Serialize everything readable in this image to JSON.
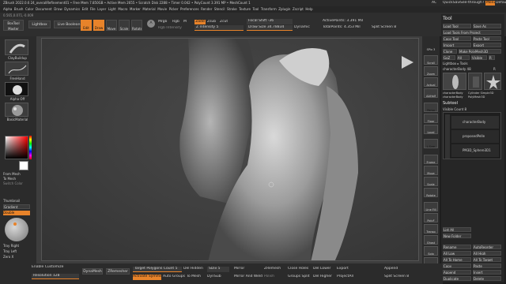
{
  "title_bar": {
    "text": "ZBrush 2022.0.6   24_overallRefinement01  •  Free Mem 7.850GB  •  Active Mem 2655  •  Scratch Disk 2288  •  Timer 0.042  •  PolyCount 3.391 MP  •  MeshCount 1",
    "right": [
      "AC",
      "QuickSave",
      "See-through 0",
      "Menus",
      "DefaultZScript"
    ]
  },
  "menu_bar": {
    "items": [
      "Alpha",
      "Brush",
      "Color",
      "Document",
      "Draw",
      "Dynamics",
      "Edit",
      "File",
      "Layer",
      "Light",
      "Macro",
      "Marker",
      "Material",
      "Movie",
      "Picker",
      "Preferences",
      "Render",
      "Stencil",
      "Stroke",
      "Texture",
      "Tool",
      "Transform",
      "Zplugin",
      "Zscript",
      "Help"
    ]
  },
  "coords": "0.565,0.071,-0.009",
  "top_shelf": {
    "boxes": [
      "BoxTool Master",
      "Lightbox",
      "Live Boolean"
    ],
    "modes": [
      "Edit",
      "Draw",
      "Move",
      "Scale",
      "Rotate"
    ],
    "a_label": "A",
    "mrgb": "Mrgb",
    "rgb": "Rgb",
    "m": "M",
    "zadd": "Zadd",
    "zsub": "Zsub",
    "zcut": "Zcut",
    "rgb_intensity": "Rgb Intensity",
    "z_intensity": "Z Intensity 5",
    "focal_shift": "Focal Shift -36",
    "draw_size": "Draw Size 34.78834",
    "dynamic": "Dynamic",
    "active_points": "ActivePoints: 3.391 Mil",
    "total_points": "TotalPoints: 4.353 Mil",
    "split_screen": "Split Screen 8"
  },
  "left_shelf": {
    "brush": "ClayBuildup",
    "stroke": "FreeHand",
    "alpha": "Alpha Off",
    "texture": "Texture Off",
    "material": "BasicMaterial",
    "from_mesh": "From Mesh",
    "to_mesh": "To Mesh",
    "switch_color": "Switch Color",
    "gradient": "Gradient",
    "thumbnail": "Thumbnail",
    "double": "Double",
    "tray_right": "Tray Right",
    "tray_left": "Tray Left",
    "zoom": "Zero X"
  },
  "right_shelf": {
    "items": [
      "SPix 3",
      "Scroll",
      "Zoom",
      "Actual",
      "AAHalf",
      "Persp",
      "Floor",
      "Local",
      "L.Sym",
      "Frame",
      "Move",
      "Scale",
      "Rotate",
      "Line Fill",
      "PolyF",
      "Transp",
      "Ghost",
      "Solo",
      "Xpose"
    ]
  },
  "tool_panel": {
    "title": "Tool",
    "buttons": [
      [
        "Load Tool",
        "Save As"
      ],
      [
        "Load Tools From Project"
      ],
      [
        "Copy Tool",
        "Paste Tool"
      ],
      [
        "Import",
        "Export"
      ],
      [
        "Clone",
        "Make PolyMesh3D"
      ],
      [
        "GoZ",
        "All",
        "Visible",
        "R"
      ]
    ],
    "lightbox_tools": "Lightbox ▸ Tools",
    "character_body": "characterBody  48",
    "r_label": "R",
    "thumbs": [
      "characterBody",
      "Cylinder Simple3D",
      "characterBody",
      "PolyMesh3D"
    ],
    "subtool_title": "Subtool",
    "visible_count": "Visible Count 8",
    "subtools": [
      "characterBody",
      "proposedPelle",
      "PM3D_Sphere3D1"
    ],
    "list_all": "List All",
    "new_folder": "New Folder",
    "rows": [
      [
        "Rename",
        "AutoReorder"
      ],
      [
        "All Low",
        "All High"
      ],
      [
        "Copy",
        "Paste"
      ],
      [
        "Append",
        "Insert"
      ],
      [
        "Duplicate",
        "Delete"
      ]
    ],
    "all_to_home": "All To Home",
    "all_to_target": "All To Target"
  },
  "bottom_shelf": {
    "enable_customize": "Enable Customize",
    "resolution": "Resolution 128",
    "dynamesh": "DynaMesh",
    "zremesher": "ZRemesher",
    "target_polygons": "Target Polygons Count 5",
    "activate_symmetry": "Activate Symmetry",
    "auto_groups": "Auto Groups",
    "to_mesh": "To Mesh",
    "del_hidden": "Del Hidden",
    "sdiv": "SDiv 5",
    "mirror": "Mirror",
    "mirror_and_weld": "Mirror And Weld",
    "zremesh": "ZRemesh",
    "close_holes": "Close Holes",
    "del_lower": "Del Lower",
    "export": "Export",
    "append": "Append",
    "groups_split": "Groups Split",
    "del_higher": "Del Higher",
    "project_all": "ProjectAll",
    "split_screen": "Split Screen 8",
    "dynsub": "DynSub",
    "polish": "Polish",
    "del_hidden2": "Del Hidden"
  },
  "colors": {
    "accent": "#e8832a",
    "bg": "#1e1e1e",
    "panel": "#2b2b2b",
    "viewport": "#3d3d3d"
  }
}
